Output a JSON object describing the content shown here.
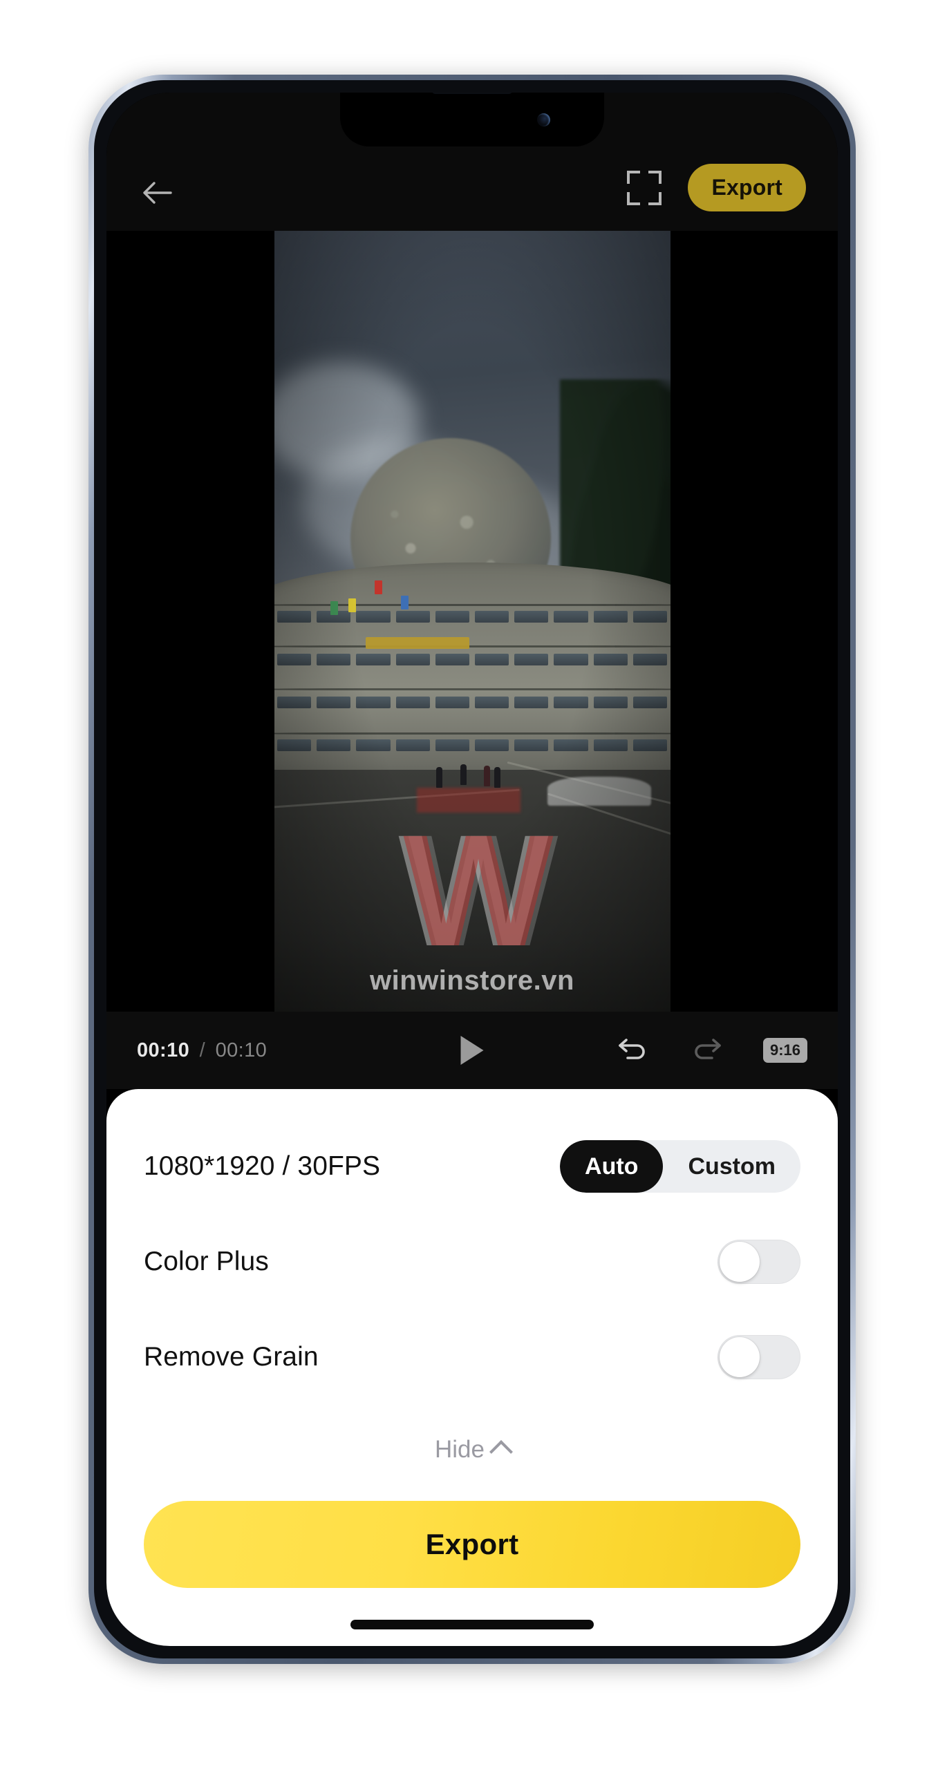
{
  "app": {
    "topbar": {
      "back_icon": "arrow-left-icon",
      "fullscreen_icon": "fullscreen-crop-icon",
      "export_label": "Export"
    },
    "video": {
      "watermark_logo": "W",
      "watermark_text": "winwinstore.vn",
      "scene_description": "curved multi-storey building under overcast sky with dome and tree"
    },
    "playbar": {
      "current_time": "00:10",
      "separator": "/",
      "total_time": "00:10",
      "play_icon": "play-icon",
      "undo_icon": "undo-icon",
      "redo_icon": "redo-icon",
      "aspect_ratio": "9:16"
    },
    "sheet": {
      "resolution_row": {
        "label": "1080*1920 / 30FPS",
        "segments": [
          {
            "label": "Auto",
            "selected": true
          },
          {
            "label": "Custom",
            "selected": false
          }
        ]
      },
      "toggles": [
        {
          "label": "Color Plus",
          "on": false
        },
        {
          "label": "Remove Grain",
          "on": false
        }
      ],
      "hide_label": "Hide",
      "hide_icon": "chevron-up-icon",
      "export_label": "Export"
    }
  },
  "colors": {
    "top_export_bg": "#b59a22",
    "main_export_bg": "#ffdf46",
    "segment_active_bg": "#101010",
    "segment_track_bg": "#eceef1",
    "switch_track_off": "#e9eaec",
    "ratio_badge_bg": "#a9a9a9",
    "sheet_bg": "#ffffff",
    "app_bg": "#000000"
  }
}
